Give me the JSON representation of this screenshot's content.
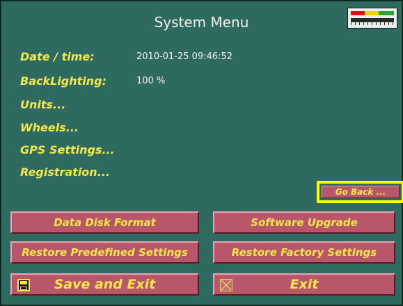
{
  "header": {
    "title": "System Menu"
  },
  "settings": {
    "date_time": {
      "label": "Date / time:",
      "value": "2010-01-25  09:46:52"
    },
    "backlighting": {
      "label": "BackLighting:",
      "value": "100 %"
    },
    "units": {
      "label": "Units..."
    },
    "wheels": {
      "label": "Wheels..."
    },
    "gps": {
      "label": "GPS Settings..."
    },
    "registration": {
      "label": "Registration..."
    }
  },
  "buttons": {
    "go_back": "Go Back ...",
    "data_disk_format": "Data Disk Format",
    "software_upgrade": "Software Upgrade",
    "restore_predefined": "Restore Predefined Settings",
    "restore_factory": "Restore Factory Settings",
    "save_and_exit": "Save and Exit",
    "exit": "Exit"
  },
  "icons": {
    "status_meter": "level-meter-icon",
    "save": "floppy-disk-icon",
    "exit": "cross-box-icon"
  },
  "colors": {
    "background": "#2e6a60",
    "button": "#b9576a",
    "label_text": "#f6e64a",
    "focus_highlight": "#ffff00"
  }
}
